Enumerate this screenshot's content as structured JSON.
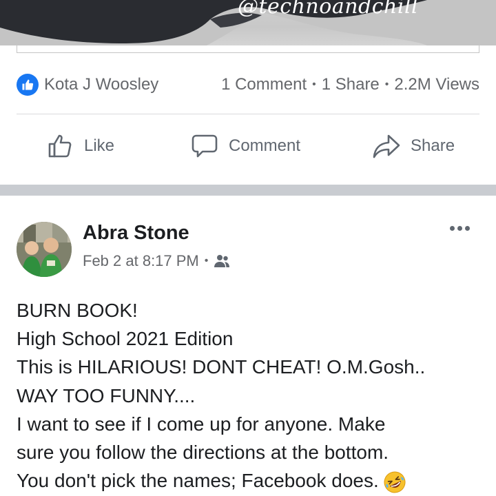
{
  "media": {
    "watermark": "@technoandchill"
  },
  "reactions": {
    "reactor_name": "Kota J Woosley",
    "comments": "1 Comment",
    "shares": "1 Share",
    "views": "2.2M Views",
    "separator": "•",
    "icon": "like-thumb-icon",
    "badge_color": "#1877f2"
  },
  "actions": {
    "like_label": "Like",
    "comment_label": "Comment",
    "share_label": "Share"
  },
  "post": {
    "author": "Abra Stone",
    "timestamp": "Feb 2 at 8:17 PM",
    "separator": "•",
    "audience_icon": "friends-icon",
    "avatar_icon": "profile-photo",
    "lines": [
      "BURN BOOK!",
      "High School 2021 Edition",
      "This is HILARIOUS! DONT CHEAT! O.M.Gosh..",
      "WAY TOO FUNNY....",
      "I want to see if I come up for anyone. Make",
      "sure you follow the directions at the bottom.",
      "You don't pick the names; Facebook does."
    ],
    "trailing_emoji": "rolling-on-floor-laughing-emoji"
  }
}
